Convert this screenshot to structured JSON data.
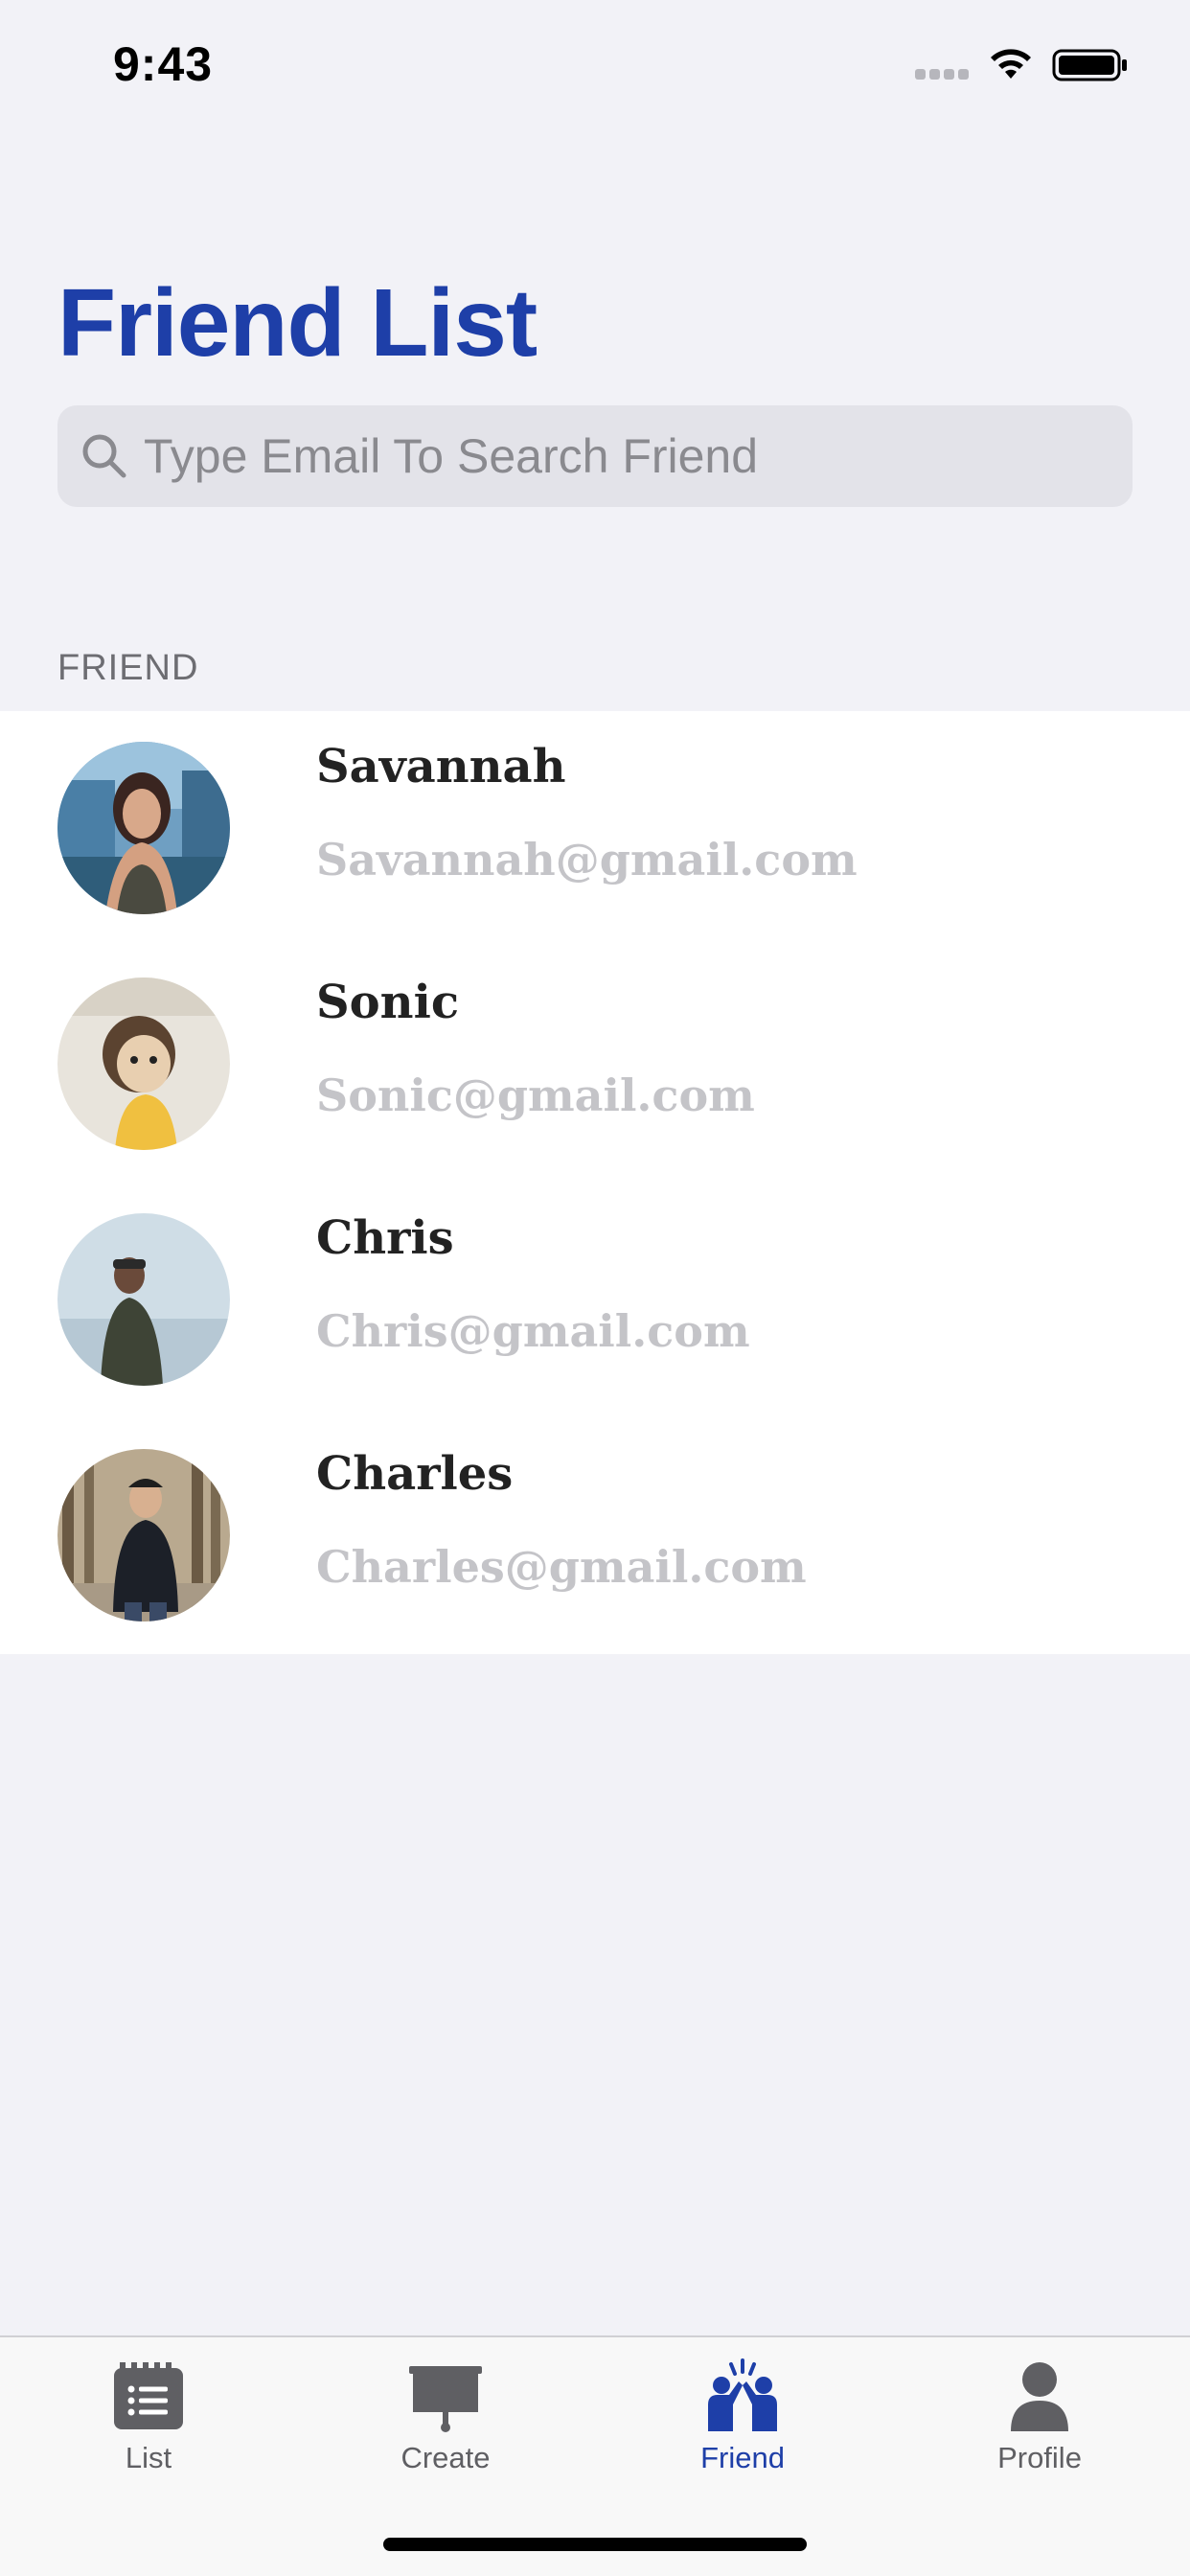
{
  "status_bar": {
    "time": "9:43"
  },
  "header": {
    "title": "Friend List"
  },
  "search": {
    "placeholder": "Type Email To Search Friend",
    "value": ""
  },
  "section": {
    "label": "FRIEND"
  },
  "friends": [
    {
      "name": "Savannah",
      "email": "Savannah@gmail.com"
    },
    {
      "name": "Sonic",
      "email": "Sonic@gmail.com"
    },
    {
      "name": "Chris",
      "email": "Chris@gmail.com"
    },
    {
      "name": "Charles",
      "email": "Charles@gmail.com"
    }
  ],
  "tab_bar": {
    "tabs": [
      {
        "label": "List",
        "icon": "list-icon",
        "active": false
      },
      {
        "label": "Create",
        "icon": "presentation-board-icon",
        "active": false
      },
      {
        "label": "Friend",
        "icon": "friends-icon",
        "active": true
      },
      {
        "label": "Profile",
        "icon": "profile-icon",
        "active": false
      }
    ]
  },
  "colors": {
    "accent": "#1e3fa8",
    "background": "#f2f2f7",
    "email_text": "#c4c4c8",
    "inactive_tab": "#5f5f63"
  }
}
